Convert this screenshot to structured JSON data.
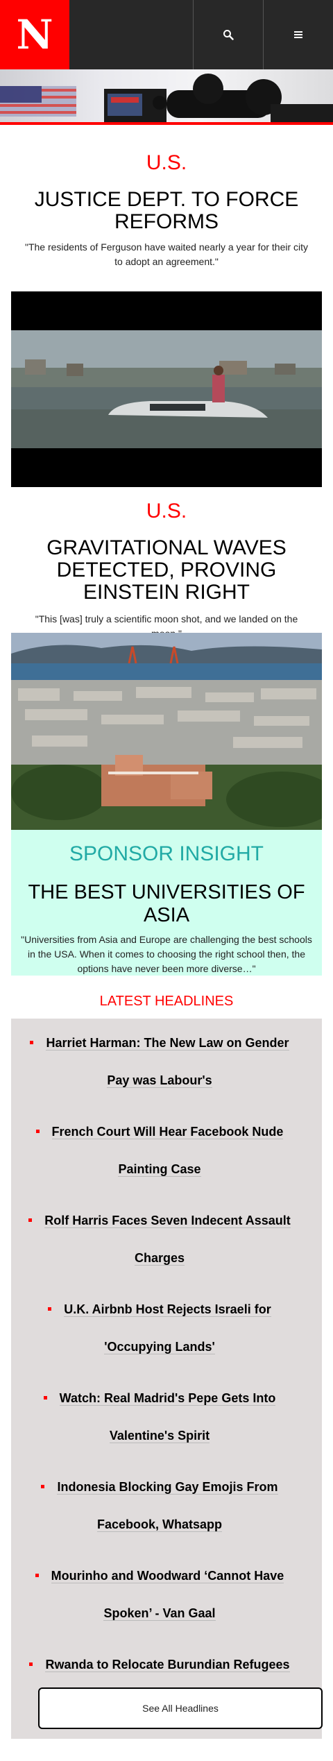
{
  "header": {
    "logo_letter": "N",
    "search_icon": "search-icon",
    "menu_icon": "hamburger-menu-icon",
    "brand_color": "#ff0000"
  },
  "stories": [
    {
      "category": "U.S.",
      "headline": "JUSTICE DEPT. TO FORCE REFORMS",
      "dek": "\"The residents of Ferguson have waited nearly a year for their city to adopt an agreement.\""
    },
    {
      "category": "U.S.",
      "headline": "GRAVITATIONAL WAVES DETECTED, PROVING EINSTEIN RIGHT",
      "dek": "\"This [was] truly a scientific moon shot, and we landed on the moon.\""
    }
  ],
  "sponsor": {
    "label": "SPONSOR INSIGHT",
    "title": "THE BEST UNIVERSITIES OF ASIA",
    "dek": "\"Universities from Asia and Europe are challenging the best schools in the USA. When it comes to choosing the right school then, the options have never been more diverse…\""
  },
  "latest": {
    "title": "LATEST HEADLINES",
    "items": [
      "Harriet Harman: The New Law on Gender Pay was Labour's",
      "French Court Will Hear Facebook Nude Painting Case",
      "Rolf Harris Faces Seven Indecent Assault Charges",
      "U.K. Airbnb Host Rejects Israeli for 'Occupying Lands'",
      "Watch: Real Madrid's Pepe Gets Into Valentine's Spirit",
      "Indonesia Blocking Gay Emojis From Facebook, Whatsapp",
      "Mourinho and Woodward ‘Cannot Have Spoken’ - Van Gaal",
      "Rwanda to Relocate Burundian Refugees"
    ],
    "see_all_label": "See All Headlines"
  }
}
